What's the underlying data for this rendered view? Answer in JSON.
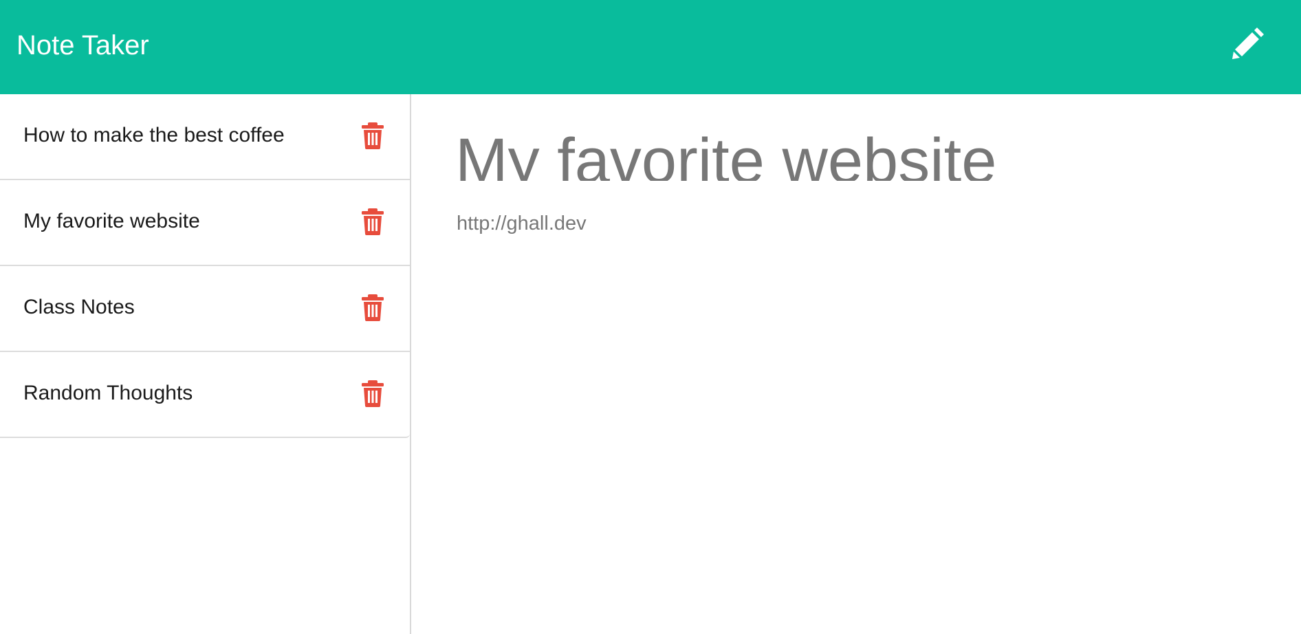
{
  "header": {
    "title": "Note Taker",
    "new_note_icon": "pencil-icon"
  },
  "sidebar": {
    "items": [
      {
        "label": "How to make the best coffee",
        "icon": "trash-icon"
      },
      {
        "label": "My favorite website",
        "icon": "trash-icon"
      },
      {
        "label": "Class Notes",
        "icon": "trash-icon"
      },
      {
        "label": "Random Thoughts",
        "icon": "trash-icon"
      }
    ]
  },
  "main": {
    "note_title": "My favorite website",
    "note_text": "http://ghall.dev"
  },
  "colors": {
    "navbar": "#09bc9c",
    "delete_icon": "#e74c3c",
    "note_text": "#777777"
  }
}
